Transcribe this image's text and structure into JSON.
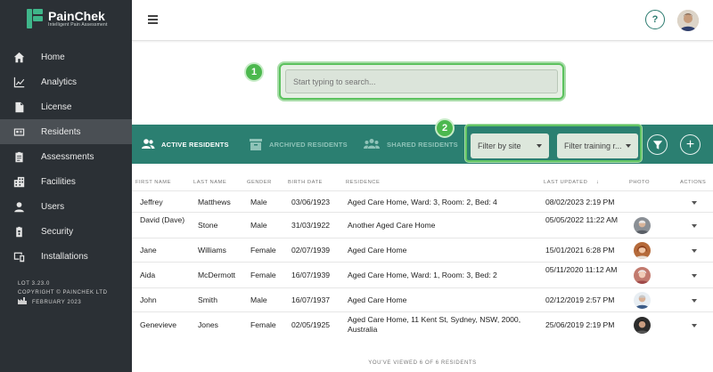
{
  "app": {
    "logo_title": "PainChek",
    "logo_sub": "Intelligent Pain Assessment"
  },
  "sidebar": {
    "items": [
      {
        "label": "Home",
        "icon": "home-icon"
      },
      {
        "label": "Analytics",
        "icon": "analytics-icon"
      },
      {
        "label": "License",
        "icon": "license-icon"
      },
      {
        "label": "Residents",
        "icon": "residents-icon",
        "active": true
      },
      {
        "label": "Assessments",
        "icon": "assessments-icon"
      },
      {
        "label": "Facilities",
        "icon": "facilities-icon"
      },
      {
        "label": "Users",
        "icon": "users-icon"
      },
      {
        "label": "Security",
        "icon": "security-icon"
      },
      {
        "label": "Installations",
        "icon": "installations-icon"
      }
    ],
    "footer": {
      "lot": "LOT 3.23.0",
      "copyright": "COPYRIGHT © PAINCHEK LTD",
      "date": "FEBRUARY 2023"
    }
  },
  "header": {
    "help_label": "?"
  },
  "search": {
    "placeholder": "Start typing to search...",
    "badge": "1"
  },
  "tabs": {
    "active": "ACTIVE RESIDENTS",
    "archived": "ARCHIVED RESIDENTS",
    "shared": "SHARED RESIDENTS"
  },
  "filters": {
    "badge": "2",
    "site": "Filter by site",
    "training": "Filter training r..."
  },
  "table": {
    "headers": {
      "first_name": "FIRST NAME",
      "last_name": "LAST NAME",
      "gender": "GENDER",
      "birth_date": "BIRTH DATE",
      "residence": "RESIDENCE",
      "last_updated": "LAST UPDATED",
      "photo": "PHOTO",
      "actions": "ACTIONS"
    },
    "rows": [
      {
        "first": "Jeffrey",
        "last": "Matthews",
        "gender": "Male",
        "birth": "03/06/1923",
        "residence": "Aged Care Home, Ward: 3, Room: 2, Bed: 4",
        "updated": "08/02/2023 2:19 PM",
        "photo": false
      },
      {
        "first": "David (Dave)",
        "last": "Stone",
        "gender": "Male",
        "birth": "31/03/1922",
        "residence": "Another Aged Care Home",
        "updated": "05/05/2022 11:22 AM",
        "photo": true
      },
      {
        "first": "Jane",
        "last": "Williams",
        "gender": "Female",
        "birth": "02/07/1939",
        "residence": "Aged Care Home",
        "updated": "15/01/2021 6:28 PM",
        "photo": true
      },
      {
        "first": "Aida",
        "last": "McDermott",
        "gender": "Female",
        "birth": "16/07/1939",
        "residence": "Aged Care Home, Ward: 1, Room: 3, Bed: 2",
        "updated": "05/11/2020 11:12 AM",
        "photo": true
      },
      {
        "first": "John",
        "last": "Smith",
        "gender": "Male",
        "birth": "16/07/1937",
        "residence": "Aged Care Home",
        "updated": "02/12/2019 2:57 PM",
        "photo": true
      },
      {
        "first": "Genevieve",
        "last": "Jones",
        "gender": "Female",
        "birth": "02/05/1925",
        "residence": "Aged Care Home, 11 Kent St, Sydney, NSW, 2000, Australia",
        "updated": "25/06/2019 2:19 PM",
        "photo": true
      }
    ]
  },
  "footer_note": "YOU'VE VIEWED 6 OF 6 RESIDENTS"
}
